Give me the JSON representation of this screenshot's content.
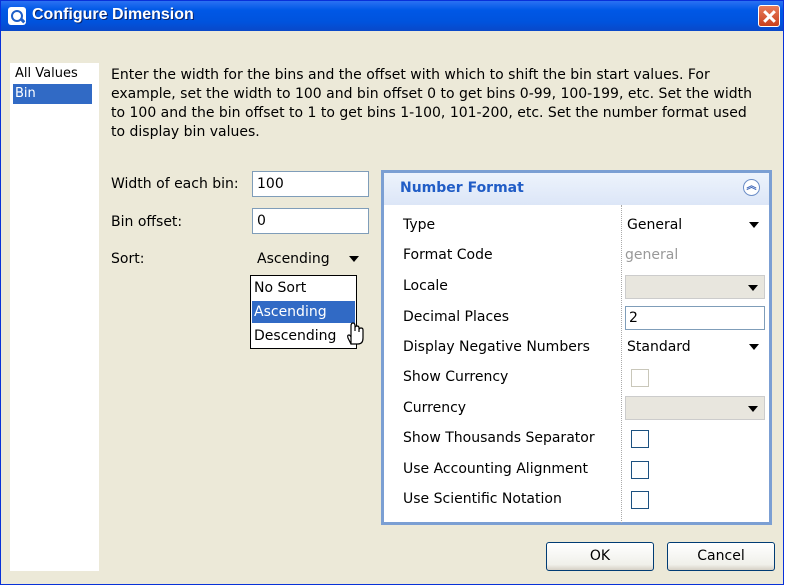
{
  "window": {
    "title": "Configure Dimension"
  },
  "left_list": {
    "items": [
      "All Values",
      "Bin"
    ],
    "selected": "Bin"
  },
  "description": "Enter the width for the bins and the offset with which to shift the bin start values. For example, set the width to 100 and bin offset 0 to get bins 0-99, 100-199, etc. Set the width to 100 and the bin offset to 1 to get bins 1-100, 101-200, etc. Set the number format used to display bin values.",
  "form": {
    "width_label": "Width of each bin:",
    "width_value": "100",
    "offset_label": "Bin offset:",
    "offset_value": "0",
    "sort_label": "Sort:",
    "sort_value": "Ascending",
    "sort_options": [
      "No Sort",
      "Ascending",
      "Descending"
    ],
    "sort_highlighted": "Ascending"
  },
  "number_format": {
    "title": "Number Format",
    "type": {
      "label": "Type",
      "value": "General"
    },
    "format_code": {
      "label": "Format Code",
      "value": "general"
    },
    "locale": {
      "label": "Locale",
      "value": ""
    },
    "decimal_places": {
      "label": "Decimal Places",
      "value": "2"
    },
    "negative_numbers": {
      "label": "Display Negative Numbers",
      "value": "Standard"
    },
    "show_currency": {
      "label": "Show Currency",
      "checked": false
    },
    "currency": {
      "label": "Currency",
      "value": ""
    },
    "thousands_separator": {
      "label": "Show Thousands Separator",
      "checked": false
    },
    "accounting_alignment": {
      "label": "Use Accounting Alignment",
      "checked": false
    },
    "scientific_notation": {
      "label": "Use Scientific Notation",
      "checked": false
    }
  },
  "buttons": {
    "ok": "OK",
    "cancel": "Cancel"
  },
  "colors": {
    "titlebar": "#0058E6",
    "selection": "#316AC5",
    "panel_border": "#7B9FD3",
    "panel_title": "#215DC6"
  }
}
